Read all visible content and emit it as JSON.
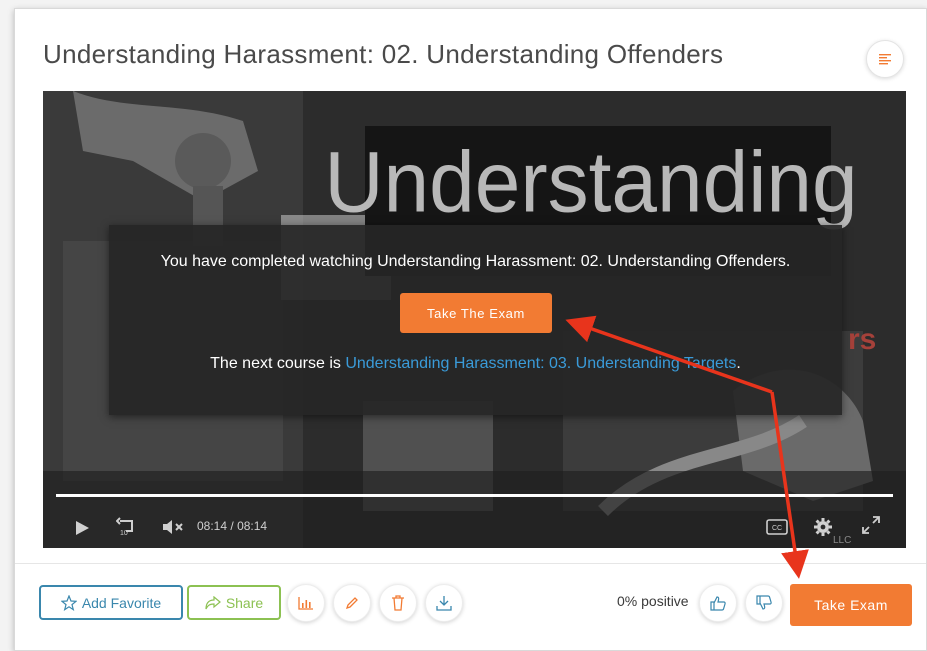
{
  "course": {
    "title": "Understanding Harassment: 02. Understanding Offenders"
  },
  "video": {
    "poster_text": "Understanding",
    "poster_fragment": "rs",
    "completion_message": "You have completed watching Understanding Harassment: 02. Understanding Offenders.",
    "take_the_exam_label": "Take The Exam",
    "next_prefix": "The next course is ",
    "next_course_link": "Understanding Harassment: 03. Understanding Targets",
    "next_suffix": ".",
    "progress_fraction": 1.0,
    "time_current": "08:14",
    "time_separator": "/",
    "time_total": "08:14",
    "cc_label": "CC",
    "watermark": "LLC"
  },
  "actions": {
    "add_favorite_label": "Add Favorite",
    "share_label": "Share",
    "positive_text": "0% positive",
    "take_exam_label": "Take Exam"
  },
  "colors": {
    "accent_orange": "#f27b33",
    "favorite_blue": "#3a87ad",
    "share_green": "#8cc152",
    "link_blue": "#3a9bd9",
    "annotation_red": "#e8341c"
  },
  "icons": {
    "toc": "list-icon",
    "play": "play-icon",
    "replay": "replay-10-icon",
    "mute": "mute-icon",
    "captions": "closed-captions-icon",
    "settings": "gear-icon",
    "fullscreen": "fullscreen-icon",
    "favorite": "star-icon",
    "share": "share-icon",
    "stats": "bar-chart-icon",
    "edit": "pencil-icon",
    "delete": "trash-icon",
    "download": "download-icon",
    "like": "thumbs-up-icon",
    "dislike": "thumbs-down-icon"
  }
}
